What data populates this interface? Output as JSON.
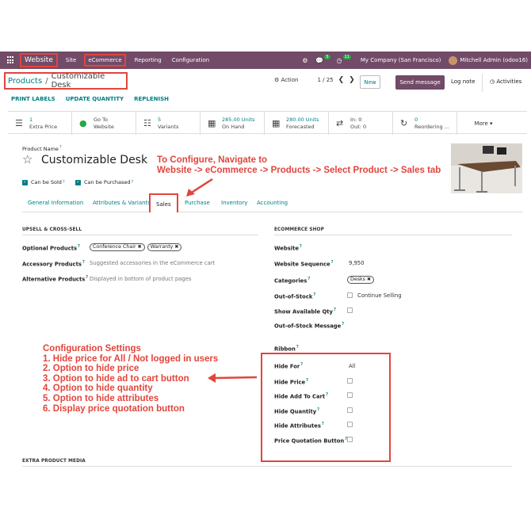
{
  "nav": {
    "app_name": "Website",
    "items": [
      "Site",
      "eCommerce",
      "Reporting",
      "Configuration"
    ],
    "chat_count": "5",
    "activity_count": "11",
    "company": "My Company (San Francisco)",
    "user": "Mitchell Admin (odoo16)"
  },
  "breadcrumb": {
    "root": "Products",
    "sep": "/",
    "current": "Customizable Desk"
  },
  "control": {
    "action": "Action",
    "pager": "1 / 25",
    "new": "New",
    "send_message": "Send message",
    "log_note": "Log note",
    "activities": "Activities"
  },
  "statusbar": [
    "PRINT LABELS",
    "UPDATE QUANTITY",
    "REPLENISH"
  ],
  "smart_buttons": [
    {
      "icon": "list-icon",
      "value": "1",
      "label": "Extra Price"
    },
    {
      "icon": "globe-icon",
      "value": "Go To",
      "label": "Website"
    },
    {
      "icon": "sitemap-icon",
      "value": "5",
      "label": "Variants"
    },
    {
      "icon": "cubes-icon",
      "value": "285.00 Units",
      "label": "On Hand"
    },
    {
      "icon": "cubes-icon",
      "value": "280.00 Units",
      "label": "Forecasted"
    },
    {
      "icon": "exchange-icon",
      "value": "In:  0",
      "label": "Out:  0"
    },
    {
      "icon": "refresh-icon",
      "value": "0",
      "label": "Reordering ..."
    }
  ],
  "more": "More",
  "product": {
    "name_label": "Product Name",
    "name": "Customizable Desk",
    "can_be_sold": "Can be Sold",
    "can_be_purchased": "Can be Purchased"
  },
  "annotation_top": [
    "To Configure, Navigate to",
    "Website -> eCommerce -> Products -> Select Product -> Sales tab"
  ],
  "tabs": [
    "General Information",
    "Attributes & Variants",
    "Sales",
    "Purchase",
    "Inventory",
    "Accounting"
  ],
  "upsell": {
    "title": "UPSELL & CROSS-SELL",
    "optional_label": "Optional Products",
    "optional_tags": [
      "Conference Chair",
      "Warranty"
    ],
    "accessory_label": "Accessory Products",
    "accessory_placeholder": "Suggested accessories in the eCommerce cart",
    "alternative_label": "Alternative Products",
    "alternative_placeholder": "Displayed in bottom of product pages"
  },
  "shop": {
    "title": "ECOMMERCE SHOP",
    "website": "Website",
    "sequence_label": "Website Sequence",
    "sequence_value": "9,950",
    "categories_label": "Categories",
    "category_tag": "Desks",
    "oos_label": "Out-of-Stock",
    "continue_selling": "Continue Selling",
    "show_qty": "Show Available Qty",
    "oos_message": "Out-of-Stock Message",
    "ribbon": "Ribbon",
    "hide_for": "Hide For",
    "hide_for_value": "All",
    "hide_price": "Hide Price",
    "hide_add_to_cart": "Hide Add To Cart",
    "hide_quantity": "Hide Quantity",
    "hide_attributes": "Hide Attributes",
    "price_quotation": "Price Quotation Button"
  },
  "annotation_bottom": [
    "Configuration Settings",
    "1. Hide price for All / Not logged in users",
    "2. Option to hide price",
    "3. Option to hide ad to cart button",
    "4. Option to hide quantity",
    "5. Option to hide attributes",
    "6. Display price quotation button"
  ],
  "extra_media": "EXTRA PRODUCT MEDIA",
  "colors": {
    "brand": "#714b67",
    "link": "#017e84",
    "annotation": "#e2453c"
  }
}
